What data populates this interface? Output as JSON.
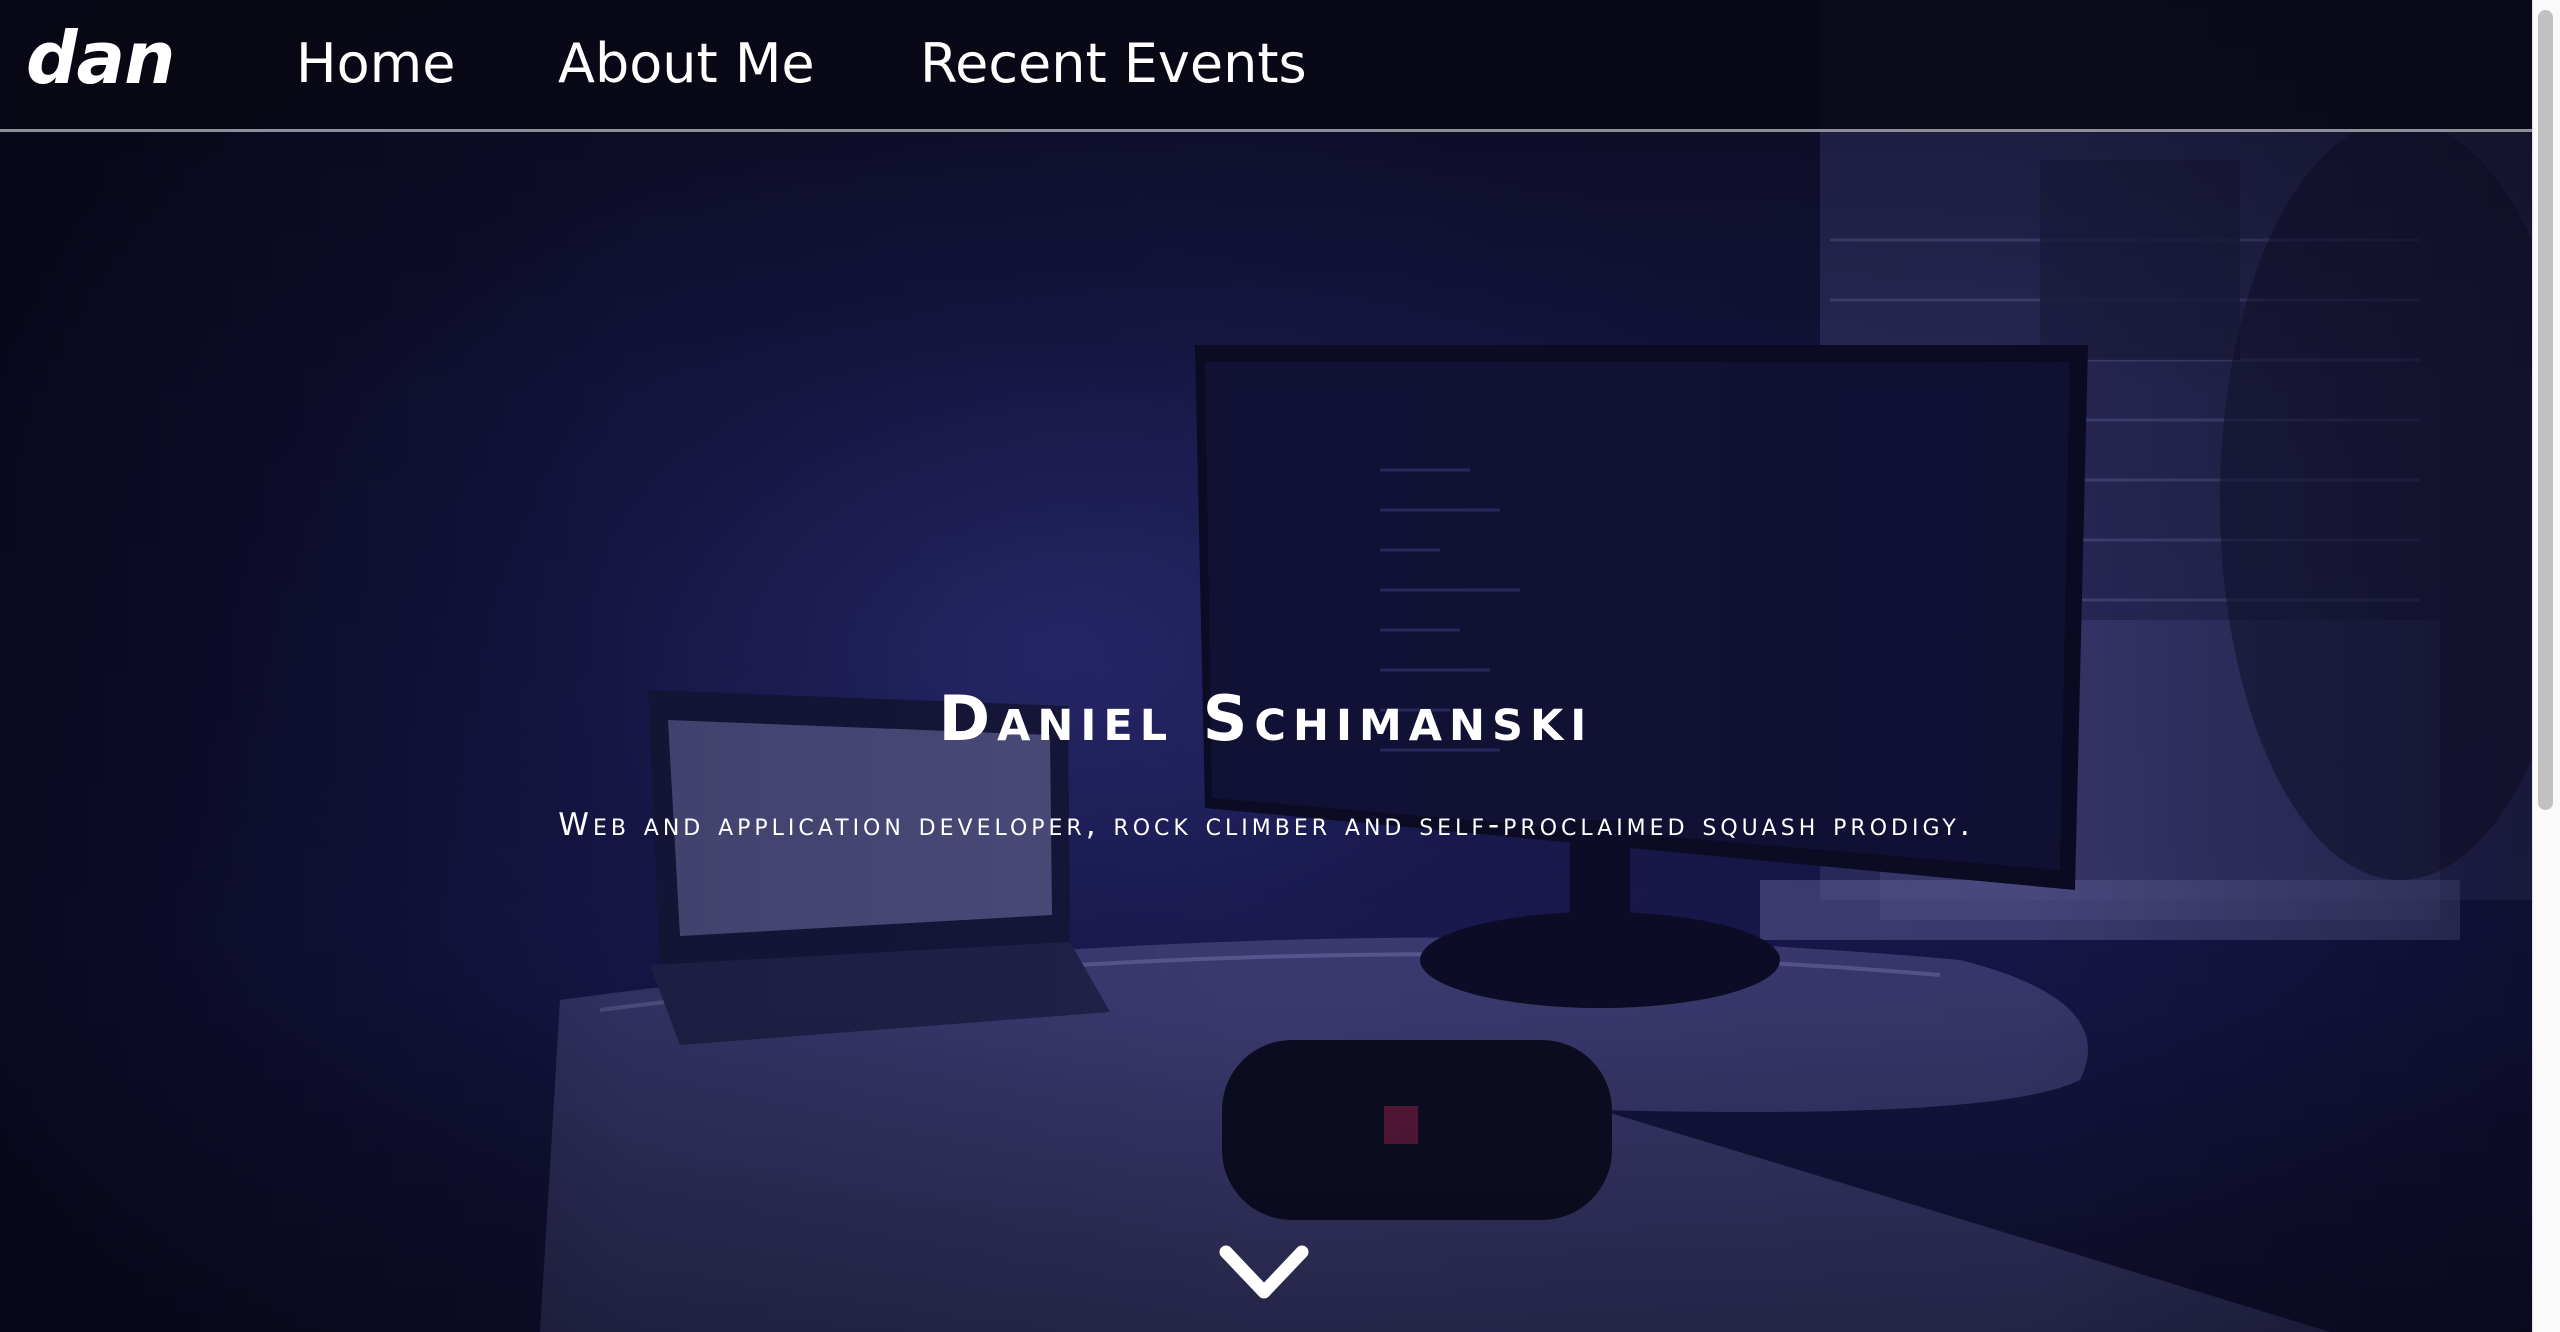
{
  "navbar": {
    "logo": "dan",
    "links": [
      {
        "label": "Home"
      },
      {
        "label": "About Me"
      },
      {
        "label": "Recent Events"
      }
    ]
  },
  "hero": {
    "title": "Daniel Schimanski",
    "subtitle": "Web and application developer, rock climber and self-proclaimed squash prodigy."
  },
  "icons": {
    "scroll_down": "chevron-down-icon"
  },
  "colors": {
    "background": "#141440",
    "navbar": "#08081a",
    "text": "#ffffff",
    "divider": "#8e8e9a"
  }
}
